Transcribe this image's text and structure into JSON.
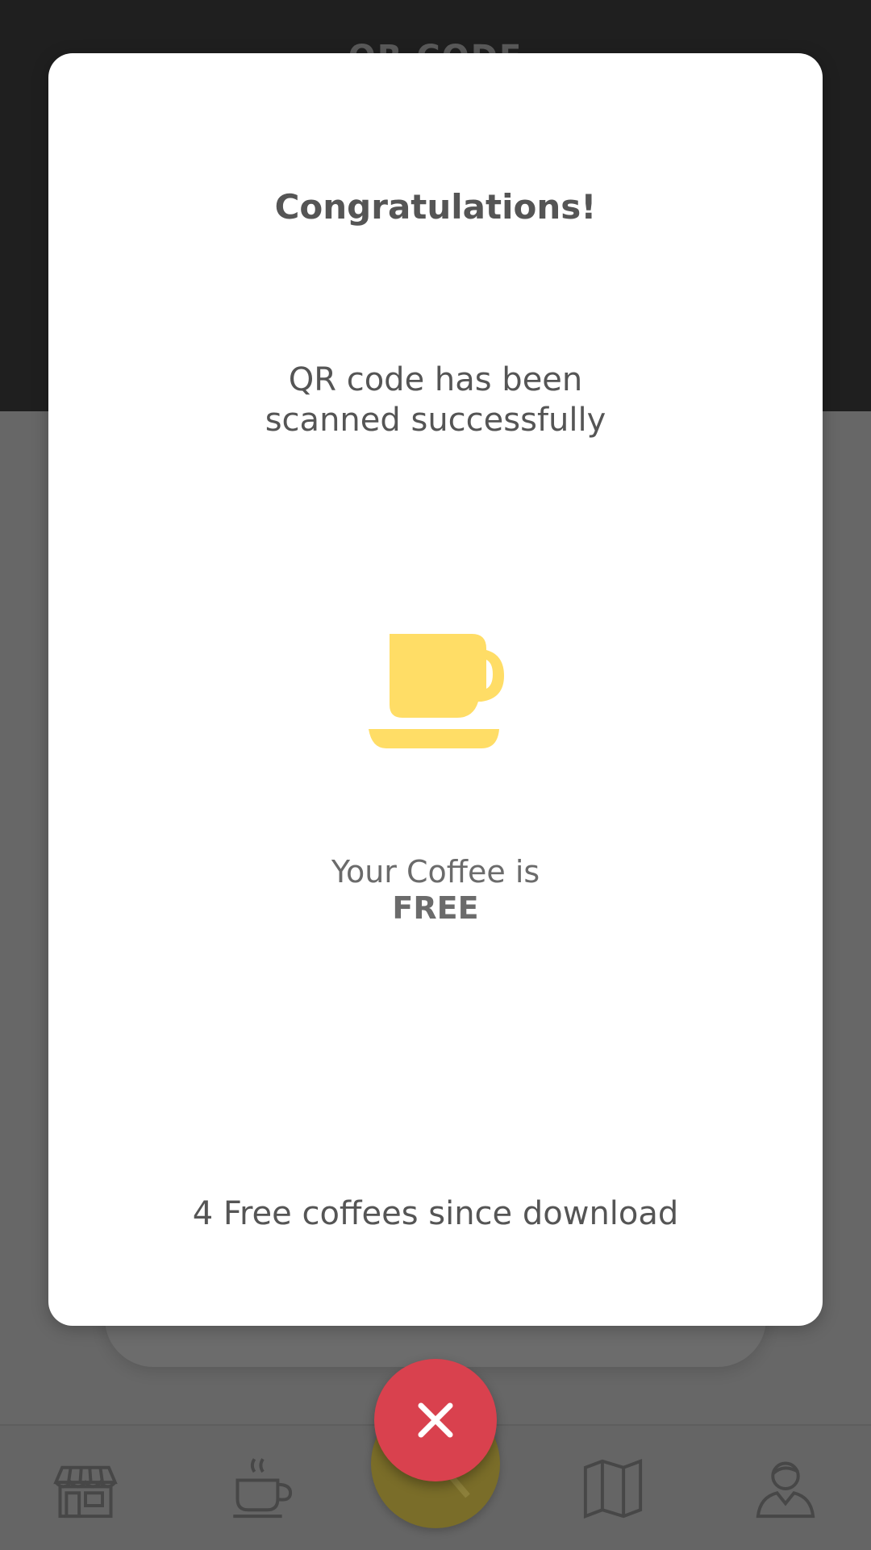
{
  "background": {
    "header_title": "QR CODE"
  },
  "modal": {
    "title": "Congratulations!",
    "message_line1": "QR code has been",
    "message_line2": "scanned successfully",
    "coffee_text": "Your Coffee is",
    "coffee_free": "FREE",
    "free_count_text": "4 Free coffees since download",
    "icon": "coffee-cup-icon",
    "accent_color": "#FFDD66"
  },
  "close_button": {
    "icon": "close-icon",
    "color": "#D9414E"
  },
  "bottom_nav": {
    "items": [
      {
        "icon": "shop-icon"
      },
      {
        "icon": "coffee-icon"
      },
      {
        "icon": "scan-icon"
      },
      {
        "icon": "map-icon"
      },
      {
        "icon": "profile-icon"
      }
    ]
  }
}
